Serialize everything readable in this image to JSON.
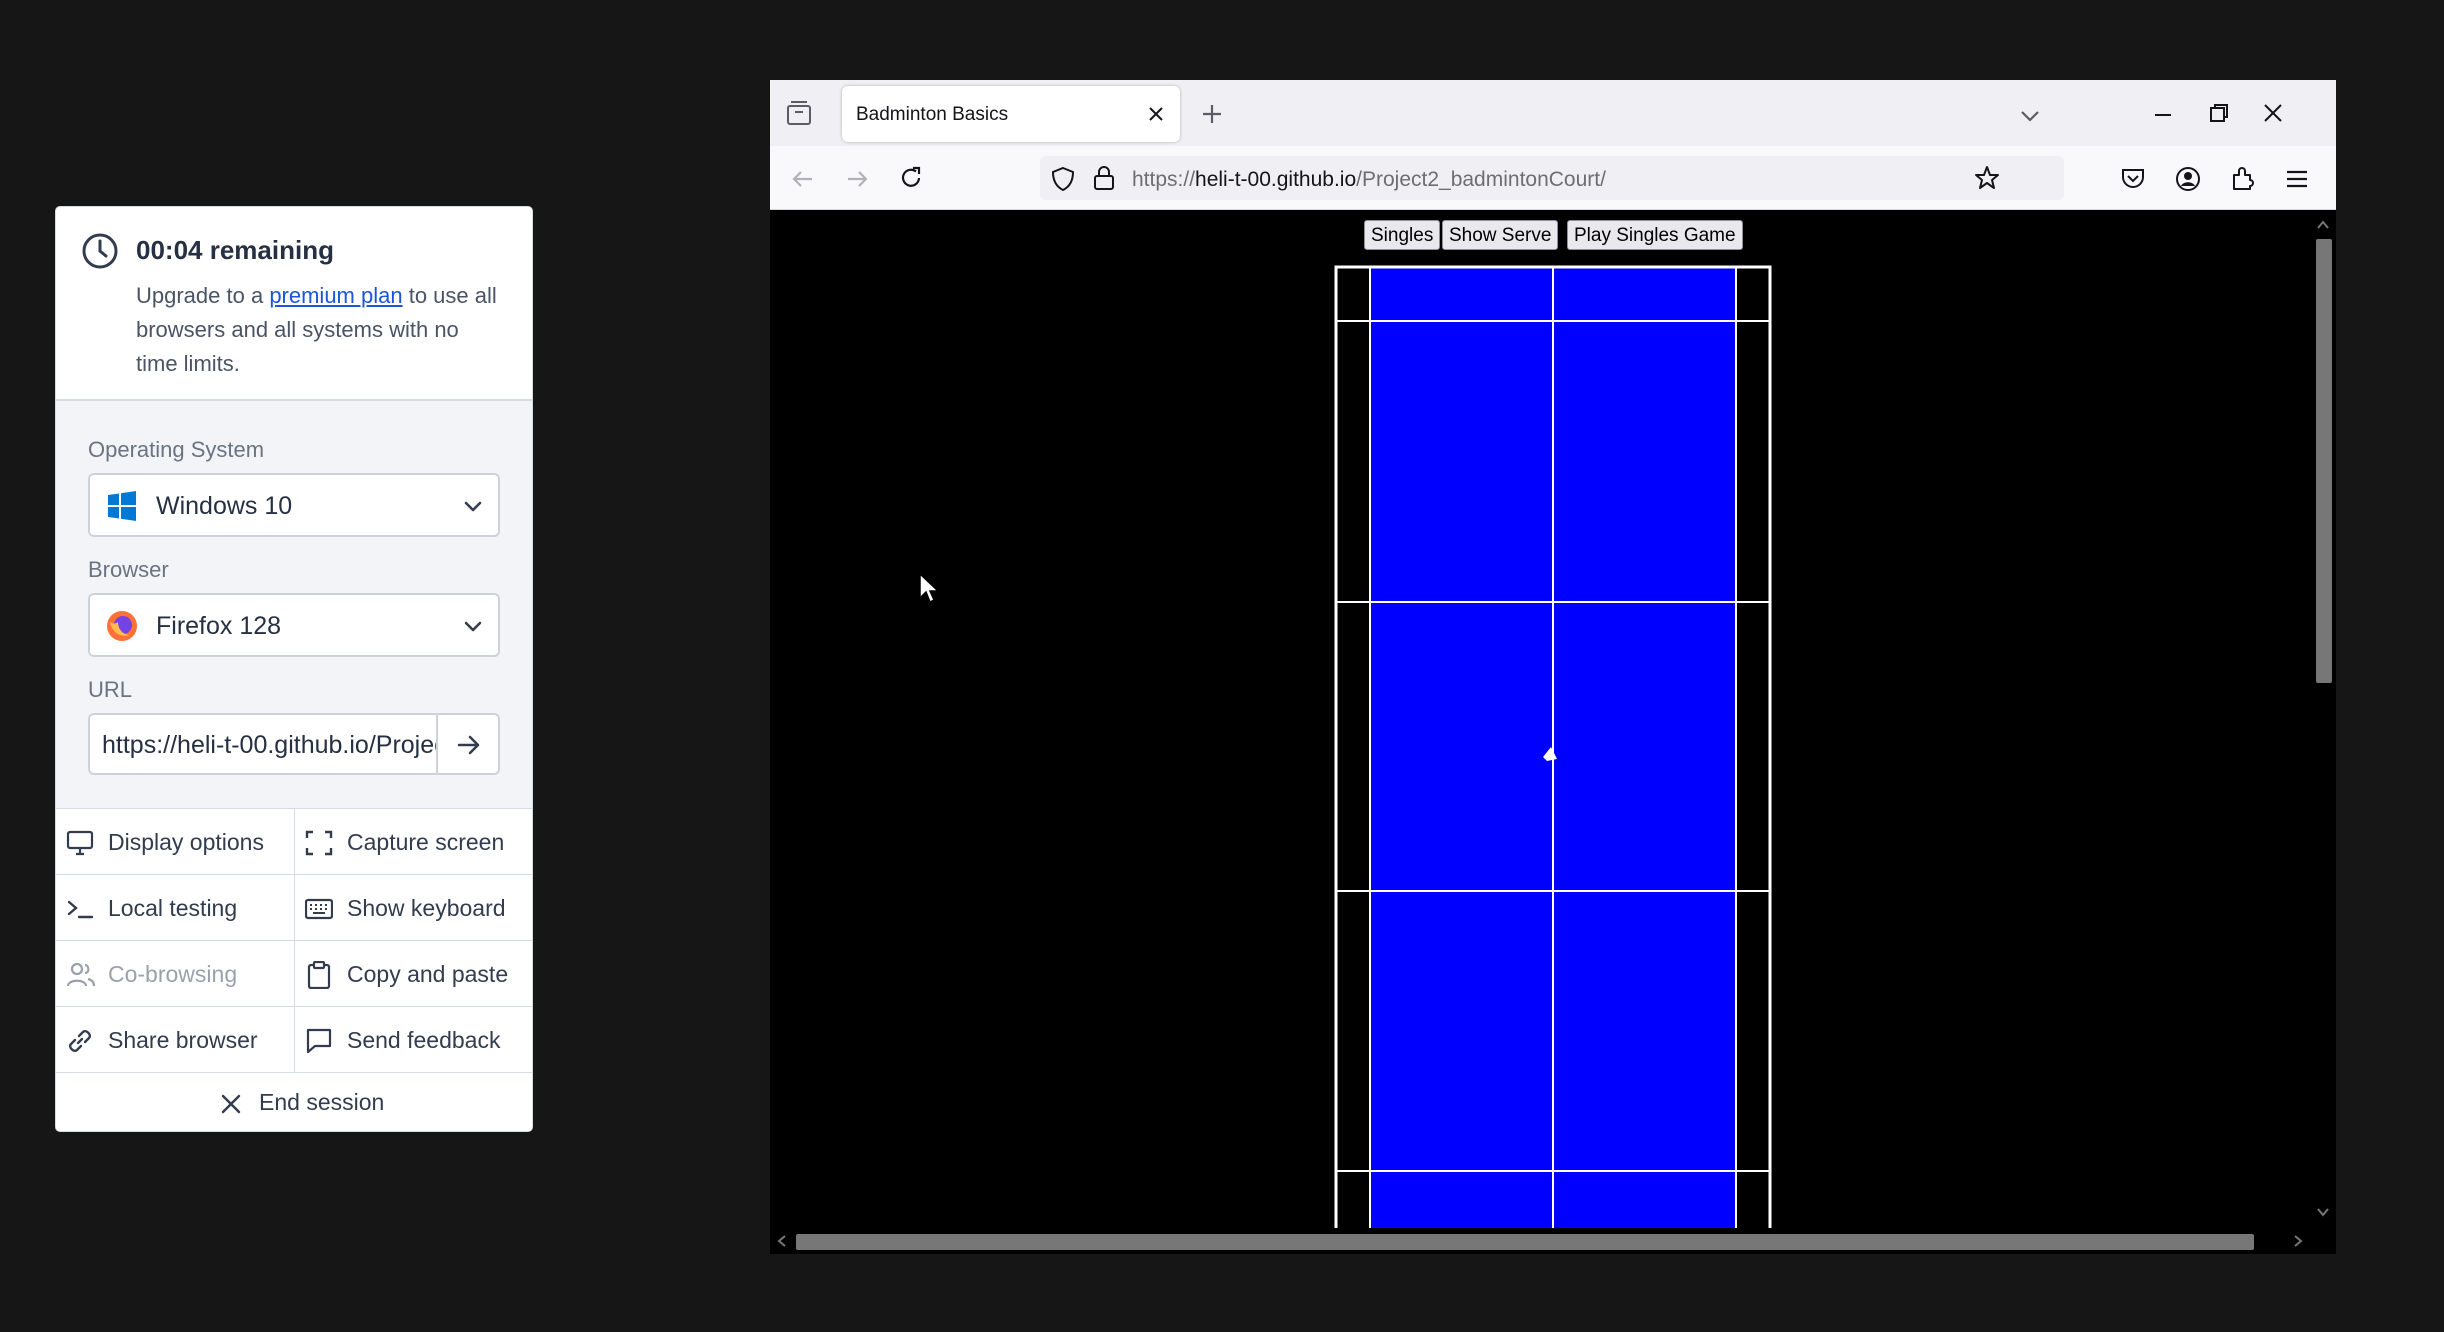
{
  "session": {
    "remaining": "00:04 remaining",
    "upgrade_prefix": "Upgrade to a ",
    "upgrade_link": "premium plan",
    "upgrade_suffix": " to use all browsers and all systems with no time limits.",
    "os_label": "Operating System",
    "os_value": "Windows 10",
    "browser_label": "Browser",
    "browser_value": "Firefox 128",
    "url_label": "URL",
    "url_value": "https://heli-t-00.github.io/Project2_badmintonCourt/",
    "actions": {
      "display_options": "Display options",
      "capture_screen": "Capture screen",
      "local_testing": "Local testing",
      "show_keyboard": "Show keyboard",
      "co_browsing": "Co-browsing",
      "copy_and_paste": "Copy and paste",
      "share_browser": "Share browser",
      "send_feedback": "Send feedback",
      "end_session": "End session"
    },
    "accent_color": "#1a56db"
  },
  "browser": {
    "tab_title": "Badminton Basics",
    "url_scheme": "https://",
    "url_host": "heli-t-00.github.io",
    "url_path": "/Project2_badmintonCourt/"
  },
  "page": {
    "buttons": [
      "Singles",
      "Show Serve",
      "Play Singles Game"
    ],
    "court_color": "#0000ff",
    "line_color": "#ffffff"
  }
}
